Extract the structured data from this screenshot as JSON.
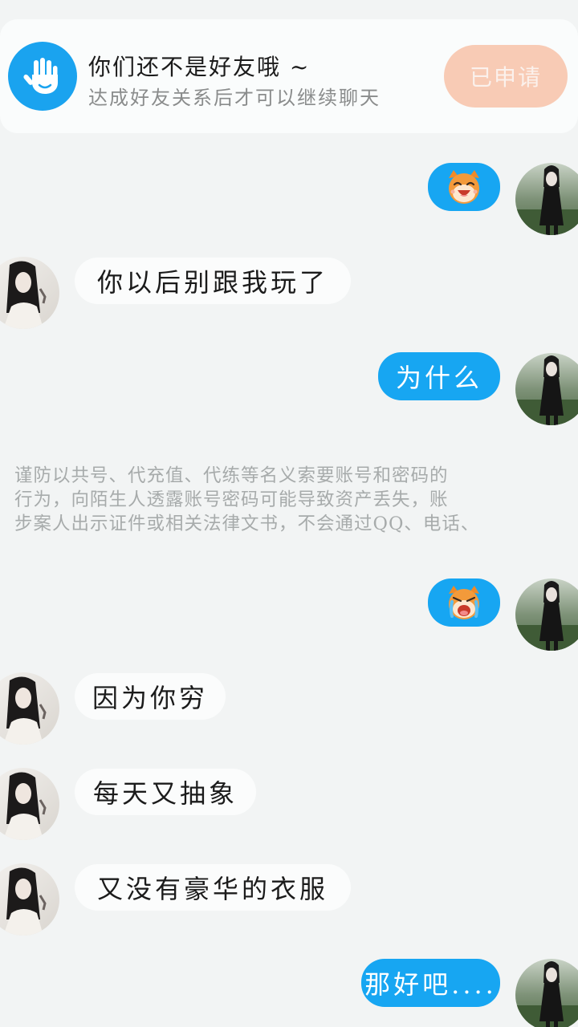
{
  "friend_banner": {
    "title": "你们还不是好友哦 ~",
    "subtitle": "达成好友关系后才可以继续聊天",
    "button_label": "已申请",
    "accent_color": "#1aa3ef",
    "button_color": "#f8cbb5"
  },
  "messages": [
    {
      "side": "out",
      "kind": "sticker",
      "icon": "laughing-cat-emoji"
    },
    {
      "side": "in",
      "kind": "text",
      "text": "你以后别跟我玩了"
    },
    {
      "side": "out",
      "kind": "text",
      "text": "为什么"
    },
    {
      "side": "out",
      "kind": "sticker",
      "icon": "crying-cat-emoji"
    },
    {
      "side": "in",
      "kind": "text",
      "text": "因为你穷"
    },
    {
      "side": "in",
      "kind": "text",
      "text": "每天又抽象"
    },
    {
      "side": "in",
      "kind": "text",
      "text": "又没有豪华的衣服"
    },
    {
      "side": "out",
      "kind": "text",
      "text": "那好吧...."
    }
  ],
  "security_notice": {
    "lines": [
      "谨防以共号、代充值、代练等名义索要账号和密码的",
      "行为，向陌生人透露账号密码可能导致资产丢失，账",
      "步案人出示证件或相关法律文书，不会通过QQ、电话、"
    ]
  },
  "colors": {
    "background": "#f2f4f4",
    "outgoing_bubble": "#17a6f2",
    "incoming_bubble": "#fbfcfc"
  }
}
